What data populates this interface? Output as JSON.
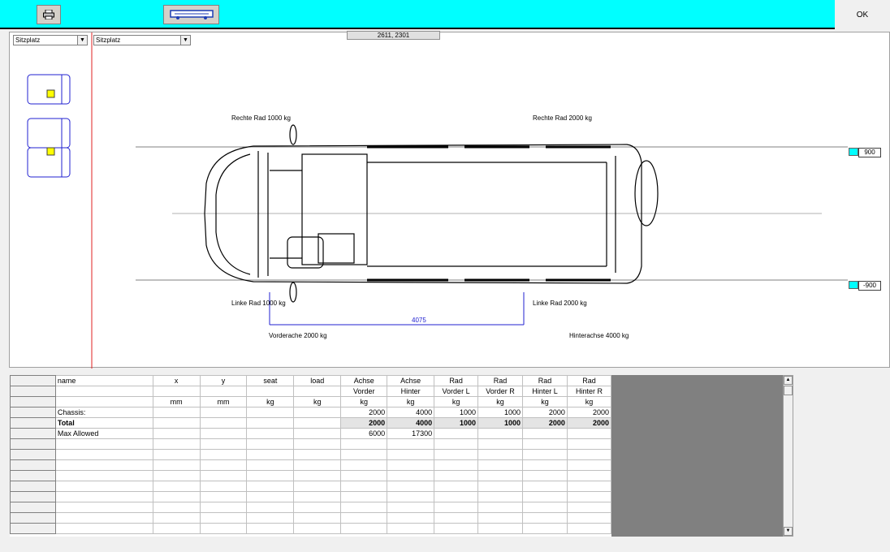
{
  "toolbar": {
    "print_icon": "printer-icon",
    "vehicle_icon": "van-icon",
    "ok_label": "OK"
  },
  "canvas": {
    "combo_left": "Sitzplatz",
    "combo_right": "Sitzplatz",
    "coords": "2611, 2301",
    "labels": {
      "rechte_rad_front": "Rechte Rad  1000 kg",
      "rechte_rad_rear": "Rechte Rad  2000 kg",
      "linke_rad_front": "Linke Rad  1000 kg",
      "linke_rad_rear": "Linke Rad  2000 kg",
      "vorderachse": "Vorderache  2000 kg",
      "hinterachse": "Hinterachse  4000 kg",
      "wheelbase": "4075"
    },
    "side_top": "900",
    "side_bottom": "-900"
  },
  "grid": {
    "header1": [
      "name",
      "x",
      "y",
      "seat",
      "load",
      "Achse",
      "Achse",
      "Rad",
      "Rad",
      "Rad",
      "Rad"
    ],
    "header2": [
      "",
      "",
      "",
      "",
      "",
      "Vorder",
      "Hinter",
      "Vorder L",
      "Vorder R",
      "Hinter L",
      "Hinter R"
    ],
    "header3": [
      "",
      "mm",
      "mm",
      "kg",
      "kg",
      "kg",
      "kg",
      "kg",
      "kg",
      "kg",
      "kg"
    ],
    "rows": [
      [
        "Chassis:",
        "",
        "",
        "",
        "",
        "2000",
        "4000",
        "1000",
        "1000",
        "2000",
        "2000"
      ],
      [
        "Total",
        "",
        "",
        "",
        "",
        "2000",
        "4000",
        "1000",
        "1000",
        "2000",
        "2000"
      ],
      [
        "Max Allowed",
        "",
        "",
        "",
        "",
        "6000",
        "17300",
        "",
        "",
        "",
        ""
      ]
    ],
    "empty_rows": 9
  }
}
